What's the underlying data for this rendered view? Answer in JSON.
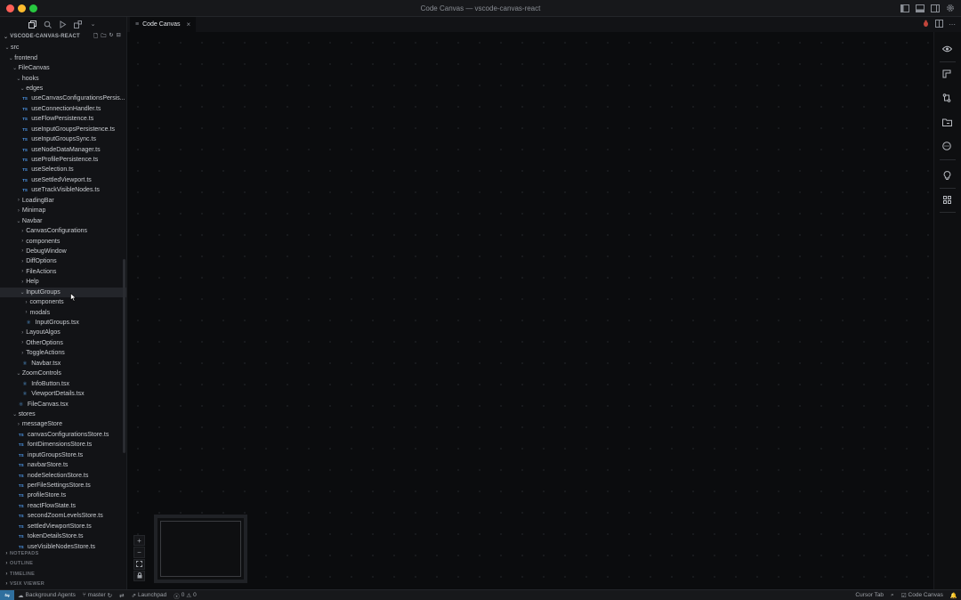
{
  "window": {
    "title": "Code Canvas — vscode-canvas-react",
    "colors": {
      "close": "#ff5f57",
      "minimize": "#febc2e",
      "maximize": "#28c840"
    }
  },
  "explorer": {
    "header": "VSCODE-CANVAS-REACT",
    "tree": [
      {
        "label": "src",
        "depth": 0,
        "type": "folder-open"
      },
      {
        "label": "frontend",
        "depth": 1,
        "type": "folder-open"
      },
      {
        "label": "FileCanvas",
        "depth": 2,
        "type": "folder-open"
      },
      {
        "label": "hooks",
        "depth": 3,
        "type": "folder-open"
      },
      {
        "label": "edges",
        "depth": 4,
        "type": "folder-open"
      },
      {
        "label": "useCanvasConfigurationsPersis...",
        "depth": 4,
        "type": "ts"
      },
      {
        "label": "useConnectionHandler.ts",
        "depth": 4,
        "type": "ts"
      },
      {
        "label": "useFlowPersistence.ts",
        "depth": 4,
        "type": "ts"
      },
      {
        "label": "useInputGroupsPersistence.ts",
        "depth": 4,
        "type": "ts"
      },
      {
        "label": "useInputGroupsSync.ts",
        "depth": 4,
        "type": "ts"
      },
      {
        "label": "useNodeDataManager.ts",
        "depth": 4,
        "type": "ts"
      },
      {
        "label": "useProfilePersistence.ts",
        "depth": 4,
        "type": "ts"
      },
      {
        "label": "useSelection.ts",
        "depth": 4,
        "type": "ts"
      },
      {
        "label": "useSettledViewport.ts",
        "depth": 4,
        "type": "ts"
      },
      {
        "label": "useTrackVisibleNodes.ts",
        "depth": 4,
        "type": "ts"
      },
      {
        "label": "LoadingBar",
        "depth": 3,
        "type": "folder"
      },
      {
        "label": "Minimap",
        "depth": 3,
        "type": "folder"
      },
      {
        "label": "Navbar",
        "depth": 3,
        "type": "folder-open"
      },
      {
        "label": "CanvasConfigurations",
        "depth": 4,
        "type": "folder"
      },
      {
        "label": "components",
        "depth": 4,
        "type": "folder"
      },
      {
        "label": "DebugWindow",
        "depth": 4,
        "type": "folder"
      },
      {
        "label": "DiffOptions",
        "depth": 4,
        "type": "folder"
      },
      {
        "label": "FileActions",
        "depth": 4,
        "type": "folder"
      },
      {
        "label": "Help",
        "depth": 4,
        "type": "folder"
      },
      {
        "label": "InputGroups",
        "depth": 4,
        "type": "folder-open",
        "selected": true
      },
      {
        "label": "components",
        "depth": 5,
        "type": "folder"
      },
      {
        "label": "modals",
        "depth": 5,
        "type": "folder"
      },
      {
        "label": "InputGroups.tsx",
        "depth": 5,
        "type": "tsx"
      },
      {
        "label": "LayoutAlgos",
        "depth": 4,
        "type": "folder"
      },
      {
        "label": "OtherOptions",
        "depth": 4,
        "type": "folder"
      },
      {
        "label": "ToggleActions",
        "depth": 4,
        "type": "folder"
      },
      {
        "label": "Navbar.tsx",
        "depth": 4,
        "type": "tsx"
      },
      {
        "label": "ZoomControls",
        "depth": 3,
        "type": "folder-open"
      },
      {
        "label": "InfoButton.tsx",
        "depth": 4,
        "type": "tsx"
      },
      {
        "label": "ViewportDetails.tsx",
        "depth": 4,
        "type": "tsx"
      },
      {
        "label": "FileCanvas.tsx",
        "depth": 3,
        "type": "tsx"
      },
      {
        "label": "stores",
        "depth": 2,
        "type": "folder-open"
      },
      {
        "label": "messageStore",
        "depth": 3,
        "type": "folder"
      },
      {
        "label": "canvasConfigurationsStore.ts",
        "depth": 3,
        "type": "ts"
      },
      {
        "label": "fontDimensionsStore.ts",
        "depth": 3,
        "type": "ts"
      },
      {
        "label": "inputGroupsStore.ts",
        "depth": 3,
        "type": "ts"
      },
      {
        "label": "navbarStore.ts",
        "depth": 3,
        "type": "ts"
      },
      {
        "label": "nodeSelectionStore.ts",
        "depth": 3,
        "type": "ts"
      },
      {
        "label": "perFileSettingsStore.ts",
        "depth": 3,
        "type": "ts"
      },
      {
        "label": "profileStore.ts",
        "depth": 3,
        "type": "ts"
      },
      {
        "label": "reactFlowState.ts",
        "depth": 3,
        "type": "ts"
      },
      {
        "label": "secondZoomLevelsStore.ts",
        "depth": 3,
        "type": "ts"
      },
      {
        "label": "settledViewportStore.ts",
        "depth": 3,
        "type": "ts"
      },
      {
        "label": "tokenDetailsStore.ts",
        "depth": 3,
        "type": "ts"
      },
      {
        "label": "useVisibleNodesStore.ts",
        "depth": 3,
        "type": "ts"
      }
    ],
    "ts_badge": "TS",
    "sections": [
      "NOTEPADS",
      "OUTLINE",
      "TIMELINE",
      "VSIX VIEWER"
    ]
  },
  "editor": {
    "tab_label": "Code Canvas",
    "tab_close": "×"
  },
  "zoom_controls": {
    "zoom_in": "+",
    "zoom_out": "−"
  },
  "help_label": "?",
  "statusbar": {
    "background_agents": "Background Agents",
    "branch": "master",
    "launchpad": "Launchpad",
    "errors": "0",
    "warnings": "0",
    "cursor_tab": "Cursor Tab",
    "code_canvas": "Code Canvas",
    "remote_color": "#2f6f9e"
  }
}
